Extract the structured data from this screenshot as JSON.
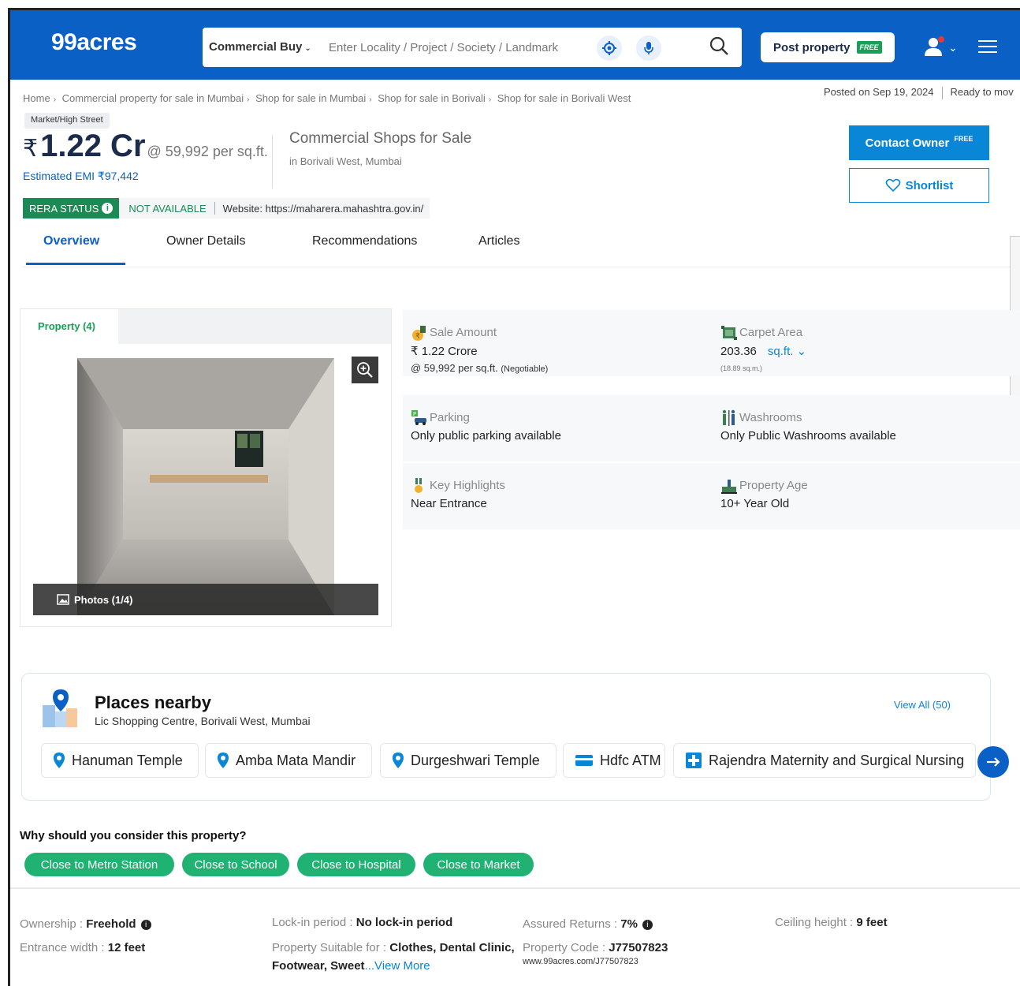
{
  "header": {
    "logo": "99acres",
    "search_type": "Commercial Buy",
    "search_placeholder": "Enter Locality / Project / Society / Landmark",
    "post_property": "Post property",
    "free_tag": "FREE"
  },
  "breadcrumb": [
    "Home",
    "Commercial property for sale in Mumbai",
    "Shop for sale in Mumbai",
    "Shop for sale in Borivali",
    "Shop for sale in Borivali West"
  ],
  "posted": {
    "date": "Posted on Sep 19, 2024",
    "status": "Ready to mov"
  },
  "listing": {
    "tag": "Market/High Street",
    "rupee": "₹",
    "price": "1.22 Cr",
    "per_sqft": "@ 59,992 per sq.ft.",
    "emi": "Estimated EMI ₹97,442",
    "type": "Commercial Shops for Sale",
    "location": "in Borivali West, Mumbai",
    "rera_status": "RERA STATUS",
    "rera_value": "NOT AVAILABLE",
    "rera_website": "Website: https://maharera.mahashtra.gov.in/",
    "contact_owner": "Contact Owner",
    "contact_free": "FREE",
    "shortlist": "Shortlist"
  },
  "tabs": [
    "Overview",
    "Owner Details",
    "Recommendations",
    "Articles"
  ],
  "gallery": {
    "tab_label": "Property (4)",
    "photos_label": "Photos (1/4)"
  },
  "details": {
    "sale_amount": {
      "label": "Sale Amount",
      "value": "₹ 1.22 Crore",
      "sub": "@ 59,992 per sq.ft.",
      "sub_note": "(Negotiable)"
    },
    "carpet_area": {
      "label": "Carpet Area",
      "value": "203.36",
      "unit": "sq.ft.",
      "sub": "(18.89 sq.m.)"
    },
    "parking": {
      "label": "Parking",
      "value": "Only public parking available"
    },
    "washrooms": {
      "label": "Washrooms",
      "value": "Only Public Washrooms available"
    },
    "key_highlights": {
      "label": "Key Highlights",
      "value": "Near Entrance"
    },
    "property_age": {
      "label": "Property Age",
      "value": "10+ Year Old"
    }
  },
  "places": {
    "title": "Places nearby",
    "subtitle": "Lic Shopping Centre, Borivali West, Mumbai",
    "view_all": "View All (50)",
    "chips": [
      "Hanuman Temple",
      "Amba Mata Mandir",
      "Durgeshwari Temple",
      "Hdfc ATM",
      "Rajendra Maternity and Surgical Nursing"
    ]
  },
  "why": {
    "title": "Why should you consider this property?",
    "chips": [
      "Close to Metro Station",
      "Close to School",
      "Close to Hospital",
      "Close to Market"
    ]
  },
  "facts": {
    "ownership_label": "Ownership :",
    "ownership_value": "Freehold",
    "entrance_label": "Entrance width :",
    "entrance_value": "12 feet",
    "lockin_label": "Lock-in period :",
    "lockin_value": "No lock-in period",
    "suitable_label": "Property Suitable for :",
    "suitable_value_1": "Clothes, Dental Clinic,",
    "suitable_value_2": "Footwear, Sweet",
    "view_more": "...View More",
    "returns_label": "Assured Returns :",
    "returns_value": "7%",
    "code_label": "Property Code :",
    "code_value": "J77507823",
    "code_url": "www.99acres.com/J77507823",
    "ceiling_label": "Ceiling height :",
    "ceiling_value": "9 feet"
  },
  "colors": {
    "brand_blue": "#0a60c4",
    "accent_blue": "#0a86d6",
    "green": "#1b8a54",
    "chip_green": "#20b273"
  }
}
